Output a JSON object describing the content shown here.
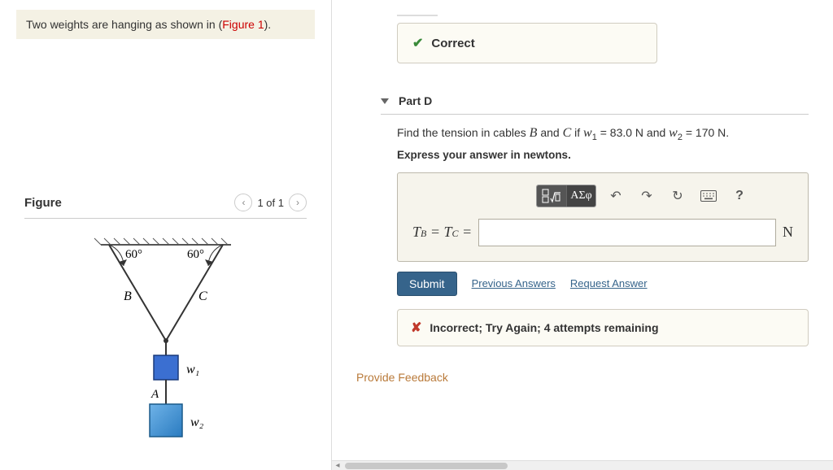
{
  "problem": {
    "text_before": "Two weights are hanging as shown in (",
    "figure_link": "Figure 1",
    "text_after": ")."
  },
  "figure": {
    "title": "Figure",
    "pager": "1 of 1",
    "angle_left": "60°",
    "angle_right": "60°",
    "label_b": "B",
    "label_c": "C",
    "label_w1": "w₁",
    "label_a": "A",
    "label_w2": "w₂"
  },
  "prev_feedback": {
    "label": "Correct"
  },
  "part": {
    "title": "Part D",
    "prompt_prefix": "Find the tension in cables ",
    "prompt_b": "B",
    "prompt_and": " and ",
    "prompt_c": "C",
    "prompt_if": " if ",
    "var_w1": "w",
    "sub1": "1",
    "eq1": " = 83.0 N",
    "and2": " and ",
    "var_w2": "w",
    "sub2": "2",
    "eq2": " = 170 N.",
    "instruct": "Express your answer in newtons.",
    "eq_label_tb": "T",
    "eq_sub_b": "B",
    "eq_eq1": " = ",
    "eq_label_tc": "T",
    "eq_sub_c": "C",
    "eq_eq2": " =",
    "answer_value": "",
    "unit": "N"
  },
  "toolbar": {
    "templates_label": "x√",
    "greek_label": "ΑΣφ",
    "undo": "↶",
    "redo": "↷",
    "reset": "↻",
    "keyboard": "⌨",
    "help": "?"
  },
  "actions": {
    "submit": "Submit",
    "previous": "Previous Answers",
    "request": "Request Answer"
  },
  "feedback": {
    "text": "Incorrect; Try Again; 4 attempts remaining"
  },
  "footer": {
    "provide": "Provide Feedback"
  }
}
